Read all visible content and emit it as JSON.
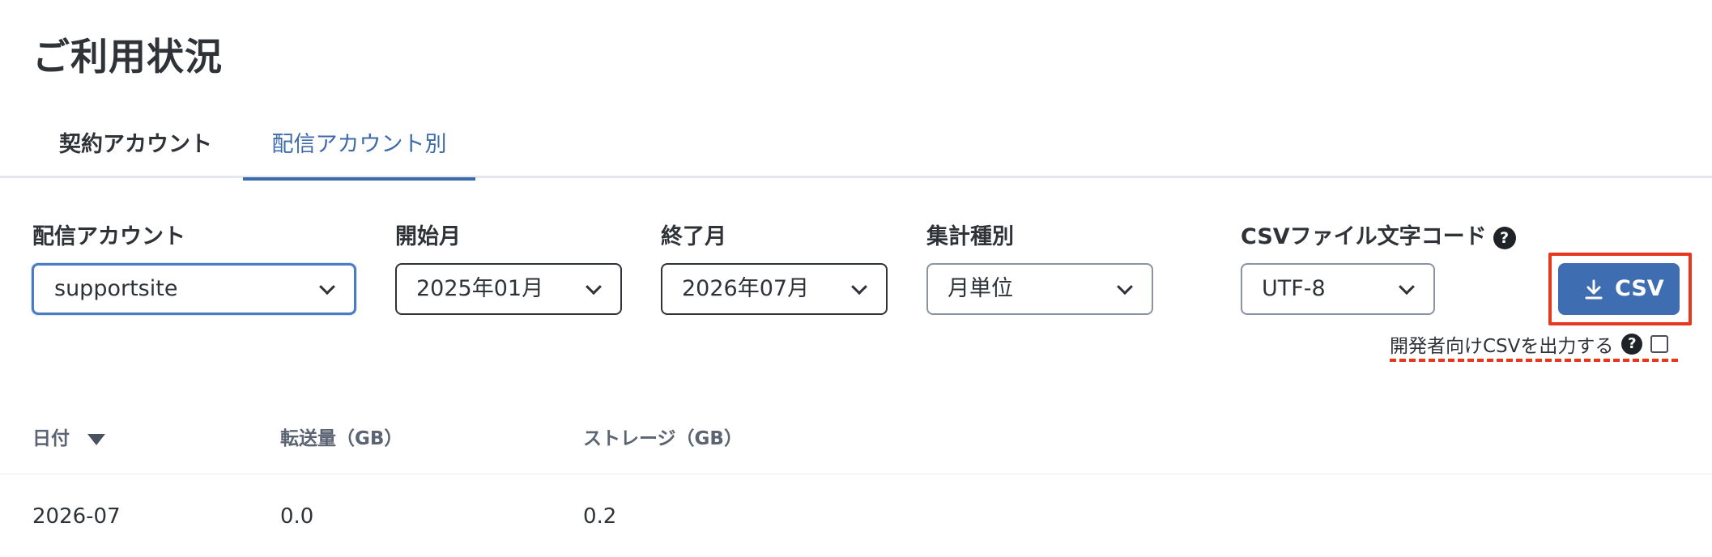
{
  "page": {
    "title": "ご利用状況"
  },
  "tabs": [
    {
      "label": "契約アカウント",
      "active": false
    },
    {
      "label": "配信アカウント別",
      "active": true
    }
  ],
  "filters": {
    "account": {
      "label": "配信アカウント",
      "value": "supportsite"
    },
    "start_month": {
      "label": "開始月",
      "value": "2025年01月"
    },
    "end_month": {
      "label": "終了月",
      "value": "2026年07月"
    },
    "aggregation": {
      "label": "集計種別",
      "value": "月単位"
    },
    "encoding": {
      "label": "CSVファイル文字コード",
      "value": "UTF-8",
      "help": "?"
    }
  },
  "export": {
    "csv_button_label": "CSV",
    "developer_csv_label": "開発者向けCSVを出力する",
    "developer_help": "?",
    "developer_checked": false
  },
  "table": {
    "headers": [
      "日付",
      "転送量（GB）",
      "ストレージ（GB）"
    ],
    "rows": [
      [
        "2026-07",
        "0.0",
        "0.2"
      ]
    ]
  },
  "colors": {
    "accent": "#3f6db2",
    "highlight": "#e5381f",
    "text": "#2f3338"
  }
}
